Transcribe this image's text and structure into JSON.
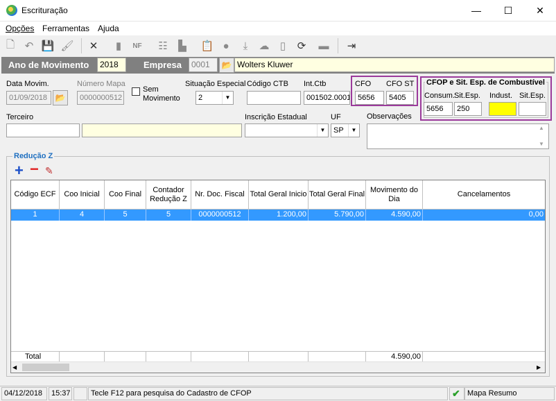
{
  "window": {
    "title": "Escrituração",
    "minimize": "—",
    "maximize": "☐",
    "close": "✕"
  },
  "menu": {
    "items": [
      "Opções",
      "Ferramentas",
      "Ajuda"
    ]
  },
  "header": {
    "ano_label": "Ano de Movimento",
    "ano_value": "2018",
    "empresa_label": "Empresa",
    "empresa_code": "0001",
    "empresa_name": "Wolters Kluwer"
  },
  "form": {
    "data_movim_label": "Data Movim.",
    "data_movim_value": "01/09/2018",
    "numero_mapa_label": "Número Mapa",
    "numero_mapa_value": "0000000512",
    "sem_movimento_label": "Sem\nMovimento",
    "situacao_label": "Situação Especial",
    "situacao_value": "2",
    "codigo_ctb_label": "Código CTB",
    "codigo_ctb_value": "",
    "int_ctb_label": "Int.Ctb",
    "int_ctb_value": "001502.0001",
    "cfo_label": "CFO",
    "cfo_value": "5656",
    "cfo_st_label": "CFO ST",
    "cfo_st_value": "5405",
    "comb_title": "CFOP e Sit. Esp. de Combustível",
    "consum_label": "Consum.",
    "consum_value": "5656",
    "sit_esp_label": "Sit.Esp.",
    "sit_esp_value": "250",
    "indust_label": "Indust.",
    "indust_value": "",
    "sit_esp2_label": "Sit.Esp.",
    "sit_esp2_value": "",
    "terceiro_label": "Terceiro",
    "terceiro_code": "",
    "terceiro_name": "",
    "inscricao_label": "Inscrição Estadual",
    "inscricao_value": "",
    "uf_label": "UF",
    "uf_value": "SP",
    "observacoes_label": "Observações",
    "observacoes_value": ""
  },
  "reducao": {
    "title": "Redução Z",
    "columns": [
      "Código ECF",
      "Coo Inicial",
      "Coo Final",
      "Contador Redução Z",
      "Nr. Doc. Fiscal",
      "Total Geral Inicio",
      "Total Geral Final",
      "Movimento do Dia",
      "Cancelamentos"
    ],
    "rows": [
      [
        "1",
        "4",
        "5",
        "5",
        "0000000512",
        "1.200,00",
        "5.790,00",
        "4.590,00",
        "0,00"
      ]
    ],
    "total_label": "Total",
    "total_movimento": "4.590,00"
  },
  "status": {
    "date": "04/12/2018",
    "time": "15:37",
    "hint": "Tecle F12 para pesquisa do Cadastro de CFOP",
    "mapa": "Mapa Resumo"
  },
  "colors": {
    "accent": "#1e6fc0",
    "highlight": "#9b3a9b",
    "selection": "#3399ff"
  }
}
